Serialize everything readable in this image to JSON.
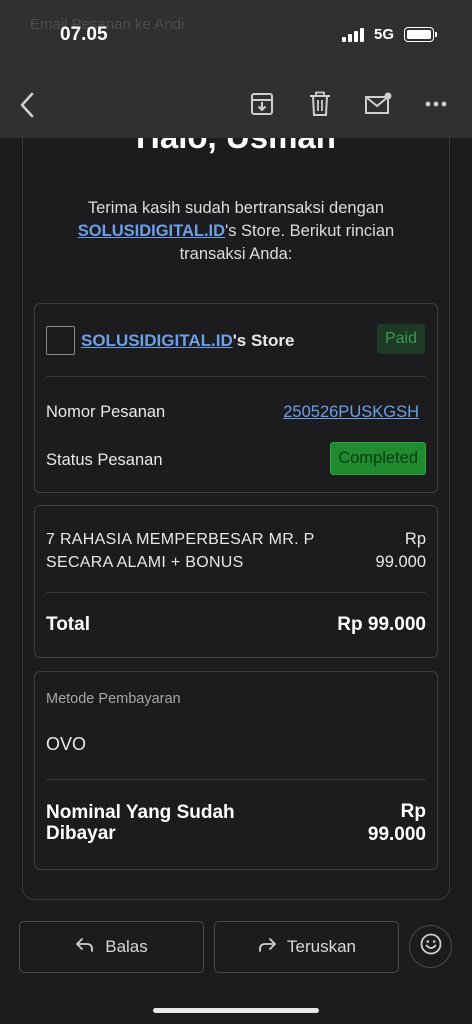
{
  "status_bar": {
    "time": "07.05",
    "network": "5G",
    "ghost_text": "Email Pesanan ke Andi"
  },
  "toolbar": {
    "icons": [
      "back-icon",
      "archive-icon",
      "trash-icon",
      "mark-unread-icon",
      "more-icon"
    ]
  },
  "email": {
    "greeting": "Halo, Usman",
    "intro_prefix": "Terima kasih sudah bertransaksi dengan",
    "intro_store_link": "SOLUSIDIGITAL.ID",
    "intro_suffix": "'s Store. Berikut rincian transaksi Anda:",
    "store": {
      "link": "SOLUSIDIGITAL.ID",
      "suffix": "'s Store",
      "paid_badge": "Paid"
    },
    "order": {
      "number_label": "Nomor Pesanan",
      "number_value": "250526PUSKGSH",
      "status_label": "Status Pesanan",
      "status_value": "Completed"
    },
    "item": {
      "name": "7 RAHASIA MEMPERBESAR MR. P SECARA ALAMI + BONUS",
      "price_currency": "Rp",
      "price_amount": "99.000"
    },
    "total": {
      "label": "Total",
      "value": "Rp 99.000"
    },
    "payment": {
      "method_label": "Metode Pembayaran",
      "method_value": "OVO",
      "paid_label": "Nominal Yang Sudah Dibayar",
      "paid_currency": "Rp",
      "paid_amount": "99.000"
    }
  },
  "actions": {
    "reply_label": "Balas",
    "forward_label": "Teruskan"
  },
  "colors": {
    "link": "#6d9fe8",
    "paid_badge_bg": "#1d3a24",
    "completed_bg": "#1f8a2e"
  }
}
